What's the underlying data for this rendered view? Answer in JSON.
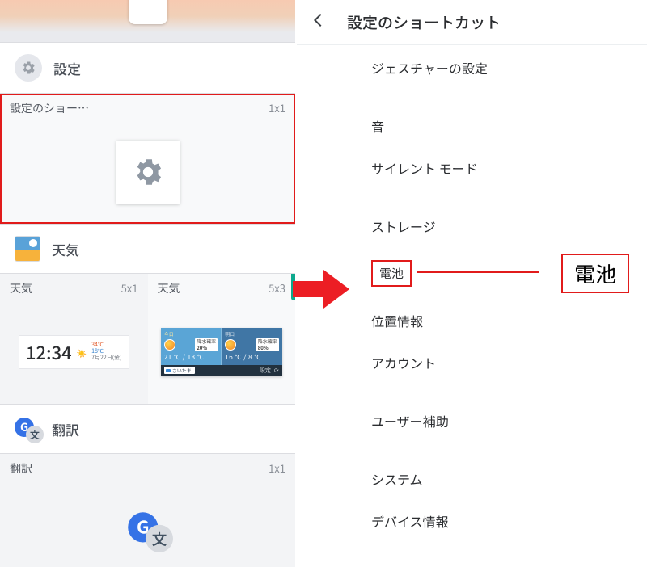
{
  "left": {
    "sections": {
      "settings": {
        "title": "設定",
        "items": [
          {
            "name": "設定のショー…",
            "size": "1x1"
          }
        ]
      },
      "weather": {
        "title": "天気",
        "items": [
          {
            "name": "天気",
            "size": "5x1",
            "clock": {
              "time": "12:34",
              "hi": "34℃",
              "lo": "18℃",
              "date": "7月22日(金)"
            }
          },
          {
            "name": "天気",
            "size": "5x3",
            "multi": {
              "today": {
                "label": "今日",
                "pop_label": "降水確率",
                "pop": "20%",
                "hi": "21",
                "lo": "13"
              },
              "tomorrow": {
                "label": "明日",
                "pop_label": "降水確率",
                "pop": "80%",
                "hi": "16",
                "lo": "8"
              },
              "location": "さいたま",
              "settings_label": "設定"
            }
          }
        ]
      },
      "translate": {
        "title": "翻訳",
        "items": [
          {
            "name": "翻訳",
            "size": "1x1"
          }
        ]
      }
    }
  },
  "right": {
    "title": "設定のショートカット",
    "items": {
      "gesture": "ジェスチャーの設定",
      "sound": "音",
      "silent": "サイレント モード",
      "storage": "ストレージ",
      "battery": "電池",
      "location": "位置情報",
      "account": "アカウント",
      "a11y": "ユーザー補助",
      "system": "システム",
      "device": "デバイス情報"
    },
    "callout_label": "電池"
  }
}
